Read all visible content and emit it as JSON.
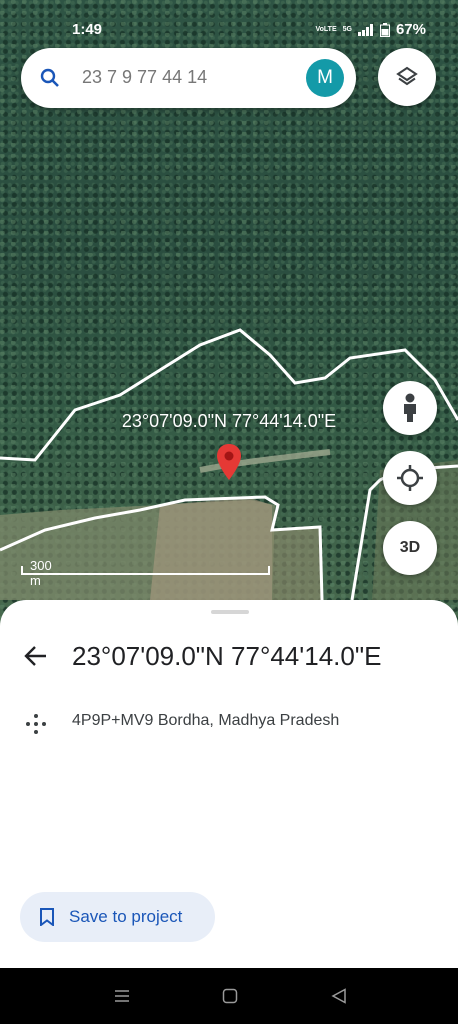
{
  "status_bar": {
    "time": "1:49",
    "volte_label": "VoLTE",
    "network_label": "5G",
    "battery": "67%"
  },
  "search": {
    "query": "23 7 9 77 44 14",
    "avatar_letter": "M"
  },
  "map": {
    "coordinate_label": "23°07'09.0\"N 77°44'14.0\"E",
    "scale_label": "300 m",
    "button_3d": "3D",
    "accent_teal": "#149aa8",
    "pin_color": "#e53935"
  },
  "sheet": {
    "title": "23°07'09.0\"N 77°44'14.0\"E",
    "plus_code": "4P9P+MV9 Bordha, Madhya Pradesh",
    "save_button": "Save to project"
  },
  "icons": [
    "search-icon",
    "layers-icon",
    "pegman-icon",
    "my-location-icon",
    "map-pin-icon",
    "back-arrow-icon",
    "plus-code-icon",
    "bookmark-icon",
    "recents-icon",
    "home-icon",
    "back-icon"
  ]
}
